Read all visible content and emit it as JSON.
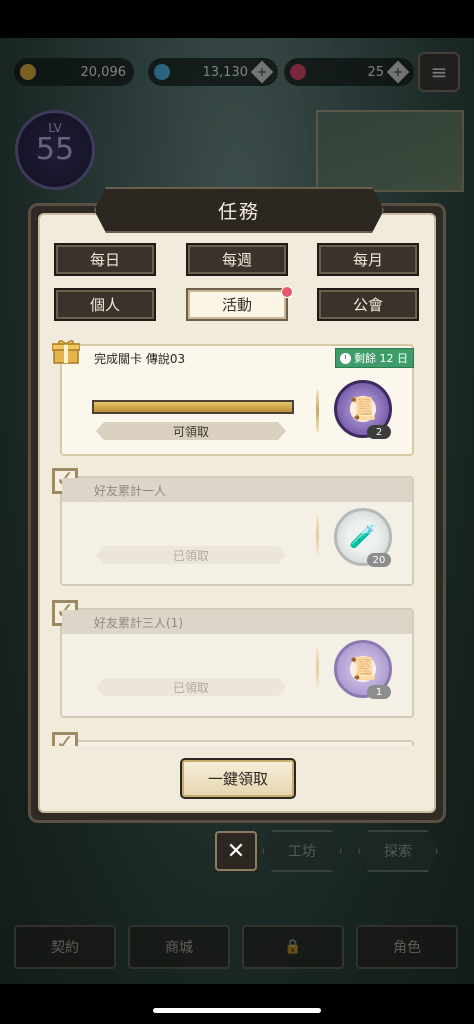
{
  "hud": {
    "gold": "20,096",
    "gems": "13,130",
    "premium": "25",
    "level_label": "LV",
    "level": "55"
  },
  "modal": {
    "title": "任務",
    "tabs": [
      {
        "label": "每日",
        "active": false
      },
      {
        "label": "每週",
        "active": false
      },
      {
        "label": "每月",
        "active": false
      },
      {
        "label": "個人",
        "active": false
      },
      {
        "label": "活動",
        "active": true
      },
      {
        "label": "公會",
        "active": false
      }
    ],
    "quests": [
      {
        "title": "完成關卡 傳說03",
        "status": "可領取",
        "progress": 1.0,
        "remaining": "剩餘 12 日",
        "reward_icon": "scroll-icon",
        "reward_qty": "2"
      },
      {
        "title": "好友累計一人",
        "status": "已領取",
        "reward_icon": "potion-icon",
        "reward_qty": "20"
      },
      {
        "title": "好友累計三人(1)",
        "status": "已領取",
        "reward_icon": "scroll-icon",
        "reward_qty": "1"
      }
    ],
    "claim_all_label": "一鍵領取"
  },
  "background_buttons": {
    "workshop": "工坊",
    "explore": "探索"
  },
  "bottom_nav": {
    "contract": "契約",
    "shop": "商城",
    "character": "角色"
  },
  "colors": {
    "panel_bg": "#f1ebdc",
    "frame_dark": "#2f2a24",
    "badge_green": "#3d9c6a",
    "progress_gold": "#d4ad4f"
  }
}
